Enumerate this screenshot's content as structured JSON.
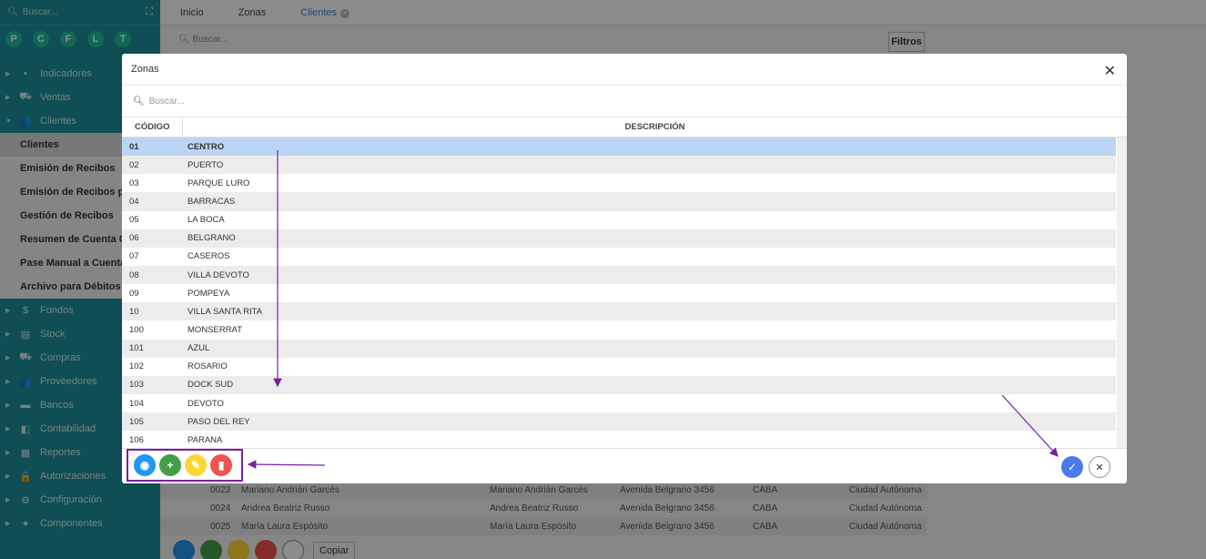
{
  "sidebar": {
    "search_placeholder": "Buscar...",
    "expand_icon": "expand-icon",
    "shortcuts": [
      "P",
      "C",
      "F",
      "L",
      "T"
    ],
    "menu_top": [
      {
        "label": "Indicadores",
        "icon": "dashboard-icon",
        "glyph": "▪"
      },
      {
        "label": "Ventas",
        "icon": "cart-icon",
        "glyph": "⛟"
      },
      {
        "label": "Clientes",
        "icon": "users-icon",
        "glyph": "👥"
      }
    ],
    "submenu": [
      {
        "label": "Clientes",
        "active": true
      },
      {
        "label": "Emisión de Recibos"
      },
      {
        "label": "Emisión de Recibos por Lote"
      },
      {
        "label": "Gestión de Recibos"
      },
      {
        "label": "Resumen de Cuenta Corriente"
      },
      {
        "label": "Pase Manual a Cuenta Corriente"
      },
      {
        "label": "Archivo para Débitos Bancarios"
      }
    ],
    "menu_bottom": [
      {
        "label": "Fondos",
        "glyph": "$"
      },
      {
        "label": "Stock",
        "glyph": "▤"
      },
      {
        "label": "Compras",
        "glyph": "⛟"
      },
      {
        "label": "Proveedores",
        "glyph": "👥"
      },
      {
        "label": "Bancos",
        "glyph": "▬"
      },
      {
        "label": "Contabilidad",
        "glyph": "◧"
      },
      {
        "label": "Reportes",
        "glyph": "▦"
      },
      {
        "label": "Autorizaciones",
        "glyph": "🔒"
      },
      {
        "label": "Configuración",
        "glyph": "⚙"
      },
      {
        "label": "Componentes",
        "glyph": "✦"
      }
    ]
  },
  "tabs": [
    {
      "label": "Inicio"
    },
    {
      "label": "Zonas"
    },
    {
      "label": "Clientes",
      "active": true
    }
  ],
  "main": {
    "search_placeholder": "Buscar...",
    "filtros_label": "Filtros",
    "copy_label": "Copiar",
    "bg_rows": [
      [
        "0023",
        "Mariano Andrián Garcés",
        "Mariano Andrián Garcés",
        "Avenida Belgrano 3456",
        "CABA",
        "Ciudad Autónoma"
      ],
      [
        "0024",
        "Andrea Beatriz Russo",
        "Andrea Beatriz Russo",
        "Avenida Belgrano 3456",
        "CABA",
        "Ciudad Autónoma"
      ],
      [
        "0025",
        "María Laura Espósito",
        "María Laura Espósito",
        "Avenida Belgrano 3456",
        "CABA",
        "Ciudad Autónoma"
      ]
    ]
  },
  "modal": {
    "title": "Zonas",
    "search_placeholder": "Buscar...",
    "col_code": "CÓDIGO",
    "col_desc": "DESCRIPCIÓN",
    "rows": [
      {
        "code": "01",
        "desc": "CENTRO",
        "selected": true
      },
      {
        "code": "02",
        "desc": "PUERTO"
      },
      {
        "code": "03",
        "desc": "PARQUE LURO"
      },
      {
        "code": "04",
        "desc": "BARRACAS"
      },
      {
        "code": "05",
        "desc": "LA BOCA"
      },
      {
        "code": "06",
        "desc": "BELGRANO"
      },
      {
        "code": "07",
        "desc": "CASEROS"
      },
      {
        "code": "08",
        "desc": "VILLA DEVOTO"
      },
      {
        "code": "09",
        "desc": "POMPEYA"
      },
      {
        "code": "10",
        "desc": "VILLA SANTA RITA"
      },
      {
        "code": "100",
        "desc": "MONSERRAT"
      },
      {
        "code": "101",
        "desc": "AZUL"
      },
      {
        "code": "102",
        "desc": "ROSARIO"
      },
      {
        "code": "103",
        "desc": "DOCK SUD"
      },
      {
        "code": "104",
        "desc": "DEVOTO"
      },
      {
        "code": "105",
        "desc": "PASO DEL REY"
      },
      {
        "code": "106",
        "desc": "PARANA"
      }
    ],
    "actions": [
      {
        "name": "view-button",
        "icon": "eye-icon",
        "color": "#2196f3",
        "glyph": "◉"
      },
      {
        "name": "add-button",
        "icon": "plus-icon",
        "color": "#43a047",
        "glyph": "+"
      },
      {
        "name": "edit-button",
        "icon": "pencil-icon",
        "color": "#fdd835",
        "glyph": "✎"
      },
      {
        "name": "delete-button",
        "icon": "trash-icon",
        "color": "#ef5350",
        "glyph": "▮"
      }
    ],
    "confirm_icon": "check-icon",
    "cancel_icon": "close-icon"
  },
  "colors": {
    "sidebar": "#1a8f9a",
    "accent": "#4a7bea",
    "selected_row": "#bcd5f5",
    "annotation": "#7b1fa2"
  }
}
